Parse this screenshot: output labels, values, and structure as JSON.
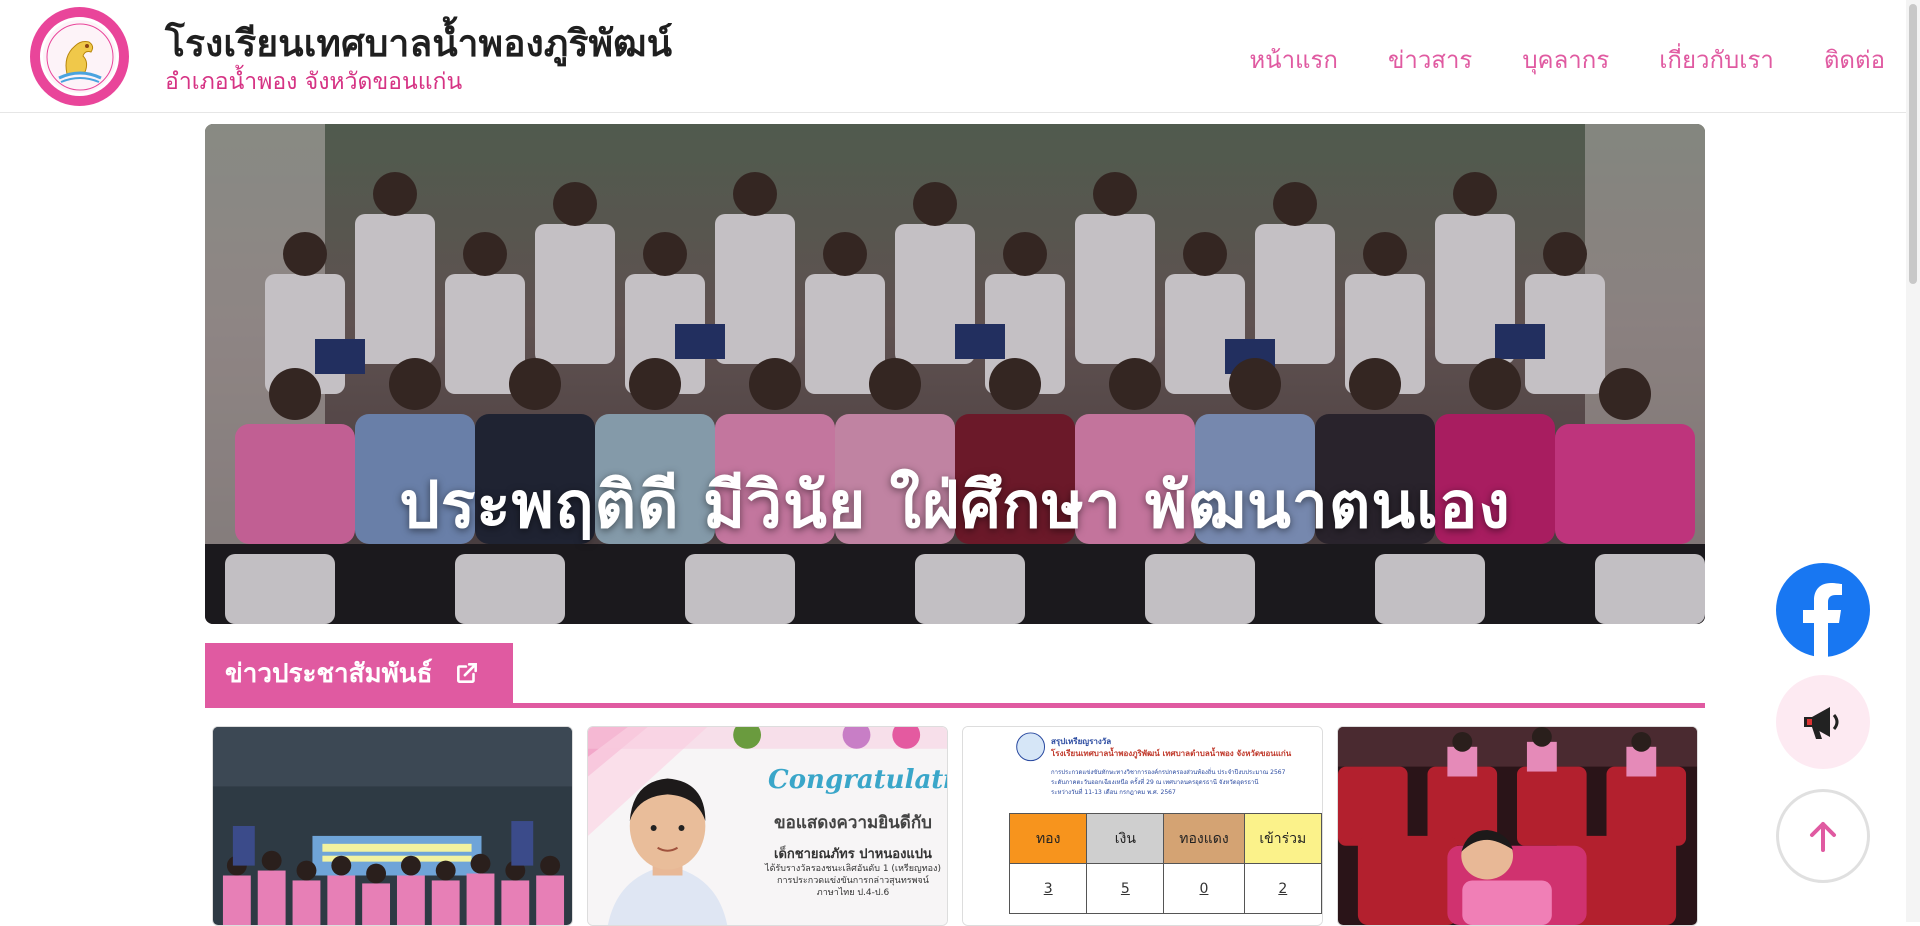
{
  "header": {
    "title": "โรงเรียนเทศบาลน้ำพองภูริพัฒน์",
    "subtitle": "อำเภอน้ำพอง จังหวัดขอนแก่น",
    "logo_icon": "school-seal-logo"
  },
  "nav": {
    "items": [
      {
        "label": "หน้าแรก"
      },
      {
        "label": "ข่าวสาร"
      },
      {
        "label": "บุคลากร"
      },
      {
        "label": "เกี่ยวกับเรา"
      },
      {
        "label": "ติดต่อ"
      }
    ]
  },
  "hero": {
    "slogan": "ประพฤติดี มีวินัย ใฝ่ศึกษา พัฒนาตนเอง"
  },
  "news_section": {
    "title": "ข่าวประชาสัมพันธ์",
    "icon": "external-link-icon"
  },
  "cards": {
    "card2": {
      "congrats": "Congratulations!",
      "line1": "ขอแสดงความยินดีกับ",
      "line2": "เด็กชายณภัทร ปาหนองแปน",
      "line3": "ได้รับรางวัลรองชนะเลิศอันดับ 1 (เหรียญทอง)",
      "line4": "การประกวดแข่งขันการกล่าวสุนทรพจน์",
      "line5": "ภาษาไทย ป.4-ป.6"
    },
    "card3": {
      "heading": "สรุปเหรียญรางวัล",
      "school": "โรงเรียนเทศบาลน้ำพองภูริพัฒน์ เทศบาลตำบลน้ำพอง จังหวัดขอนแก่น",
      "small1": "การประกวดแข่งขันทักษะทางวิชาการองค์กรปกครองส่วนท้องถิ่น ประจำปีงบประมาณ 2567",
      "small2": "ระดับภาคตะวันออกเฉียงเหนือ ครั้งที่ 29 ณ เทศบาลนครอุดรธานี จังหวัดอุดรธานี",
      "small3": "ระหว่างวันที่ 11-13 เดือน กรกฎาคม พ.ศ. 2567",
      "headers": [
        "ทอง",
        "เงิน",
        "ทองแดง",
        "เข้าร่วม"
      ],
      "values": [
        "3",
        "5",
        "0",
        "2"
      ]
    }
  },
  "floating": {
    "facebook_icon": "facebook-icon",
    "news_icon": "megaphone-icon",
    "top_icon": "arrow-up-icon"
  },
  "colors": {
    "accent_pink": "#e05aa1",
    "facebook_blue": "#1877f2"
  }
}
